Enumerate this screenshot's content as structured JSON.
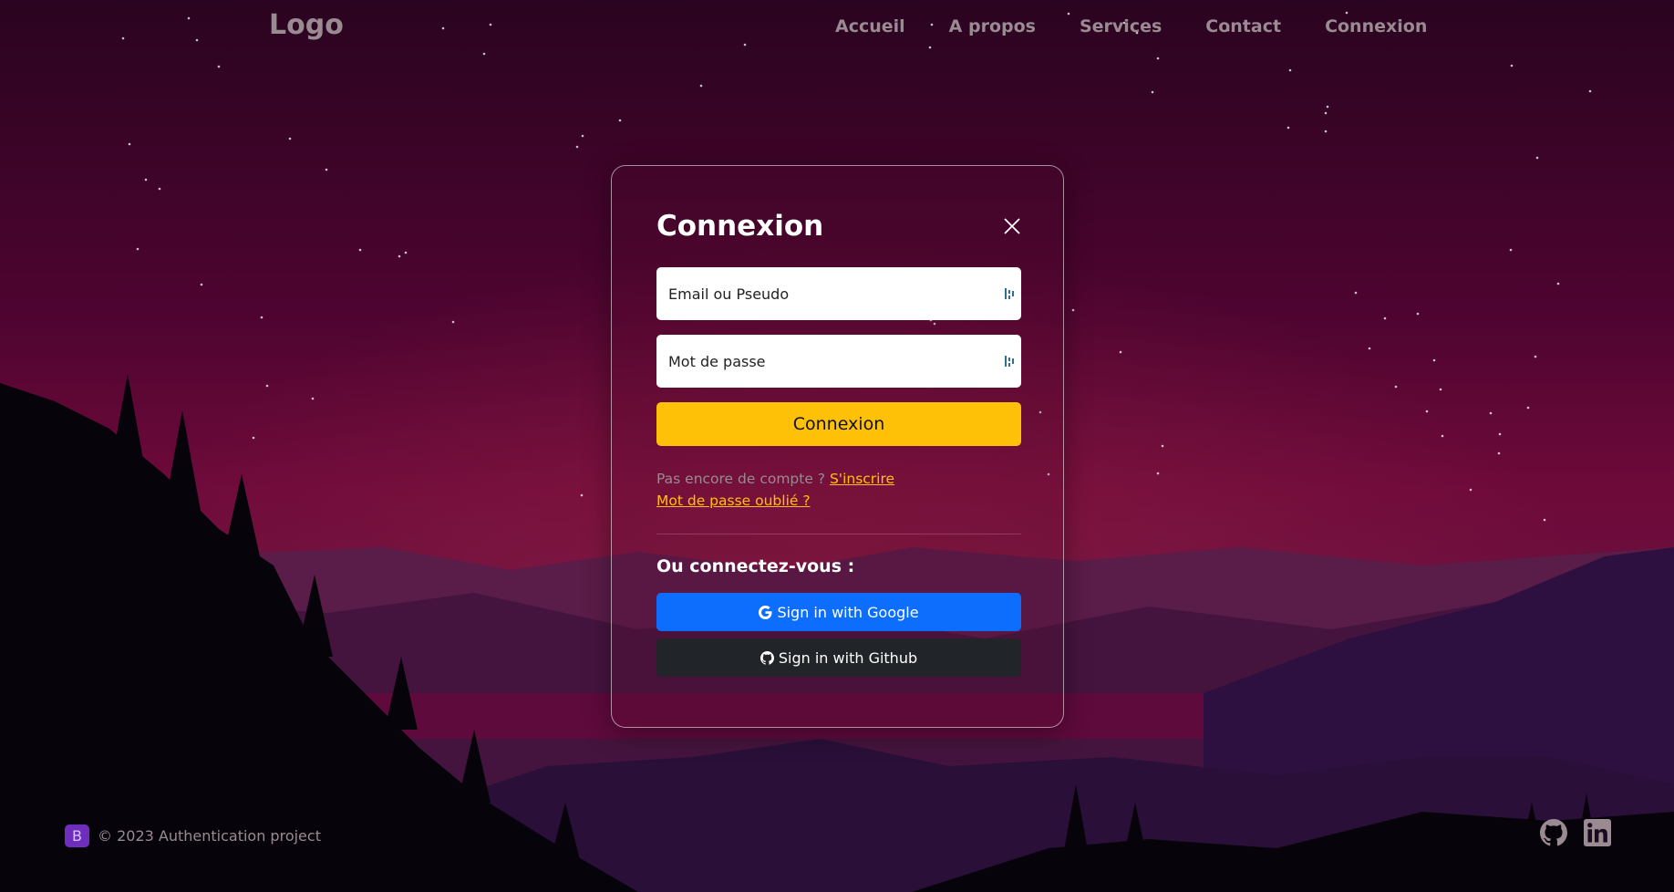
{
  "header": {
    "logo": "Logo",
    "nav": [
      "Accueil",
      "A propos",
      "Services",
      "Contact",
      "Connexion"
    ]
  },
  "login": {
    "title": "Connexion",
    "close_icon": "close-icon",
    "email_placeholder": "Email ou Pseudo",
    "password_placeholder": "Mot de passe",
    "field_icon": "password-manager-icon",
    "submit_label": "Connexion",
    "signup_prompt": "Pas encore de compte ?",
    "signup_link": "S'inscrire",
    "forgot_link": "Mot de passe oublié ?",
    "alt_title": "Ou connectez-vous :",
    "google_label": "Sign in with Google",
    "github_label": "Sign in with Github"
  },
  "footer": {
    "badge": "B",
    "copyright": "© 2023 Authentication project",
    "icons": [
      "github-icon",
      "linkedin-icon"
    ]
  },
  "colors": {
    "accent": "#ffc107",
    "google": "#0d6efd",
    "github": "#212529",
    "nav_text": "#9a8a92",
    "bootstrap": "#6f2dbd"
  }
}
